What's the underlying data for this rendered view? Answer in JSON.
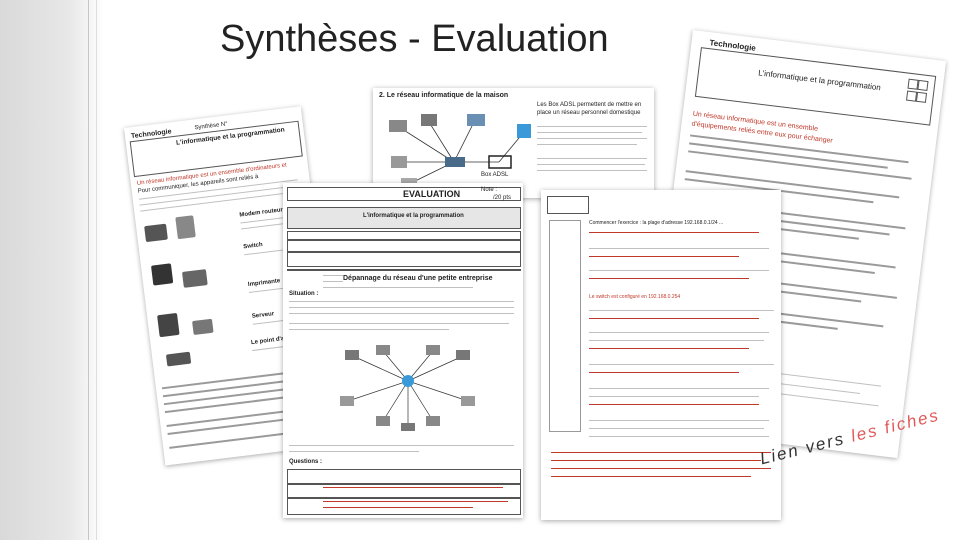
{
  "slide": {
    "title": "Synthèses - Evaluation",
    "link_text_plain": "Lien vers",
    "link_text_linked": "les fiches"
  },
  "doc_network": {
    "heading": "2. Le réseau informatique de la maison",
    "text1": "Les Box ADSL permettent de mettre en",
    "text2": "place un réseau personnel domestique",
    "caption": "Box ADSL"
  },
  "doc_cours_left": {
    "header_left": "Technologie",
    "header_mid": "Synthèse N°",
    "title": "L'informatique et la programmation",
    "body1": "Un réseau informatique est un ensemble d'ordinateurs et",
    "body2": "Pour communiquer, les appareils sont reliés à",
    "side1": "Modem routeur",
    "side2": "Switch",
    "side3": "Imprimante",
    "side4": "Serveur",
    "side5": "Le point d'accès Wi-Fi"
  },
  "doc_evaluation": {
    "title": "EVALUATION",
    "note_label": "Note :",
    "note_value": "/20 pts",
    "theme": "L'informatique et la programmation",
    "section": "Dépannage du réseau d'une petite entreprise",
    "situation": "Situation :",
    "questions": "Questions :"
  },
  "doc_answers": {
    "intro": "Commencer l'exercice : la plage d'adresse 192.168.0.1/24 ...",
    "answer_sample": "Le switch est configuré en 192.168.0.254"
  },
  "doc_rotated": {
    "header_left": "Technologie",
    "title": "L'informatique et la programmation",
    "line1": "Un réseau informatique est un ensemble",
    "line2": "d'équipements reliés entre eux pour échanger"
  },
  "colors": {
    "accent_red": "#e05a5a",
    "doc_shadow": "#999999",
    "left_band": "#d9d9d9"
  }
}
